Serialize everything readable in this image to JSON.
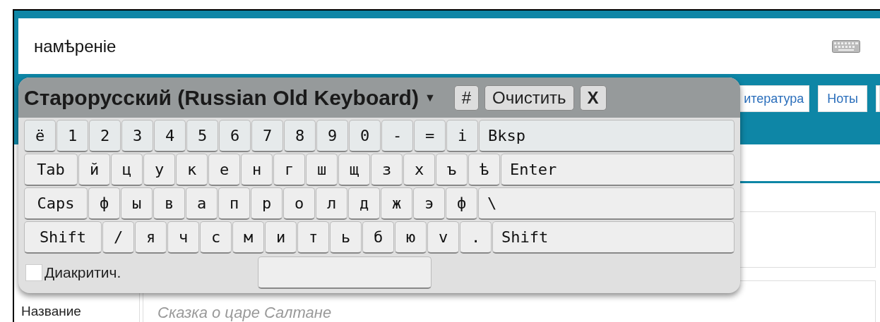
{
  "search": {
    "value": "намѣреніе"
  },
  "nav_buttons": [
    {
      "kind": "text",
      "label": "итература"
    },
    {
      "kind": "text",
      "label": "Ноты"
    },
    {
      "kind": "edge"
    }
  ],
  "form": {
    "title_label": "Название",
    "title_placeholder": "Сказка о царе Салтане"
  },
  "keyboard": {
    "title": "Старорусский (Russian Old Keyboard)",
    "dropdown": "▼",
    "buttons": [
      "#",
      "Очистить",
      "X"
    ],
    "rows": [
      {
        "keys": [
          {
            "label": "ё",
            "kind": "key"
          },
          {
            "label": "1",
            "kind": "key"
          },
          {
            "label": "2",
            "kind": "key"
          },
          {
            "label": "3",
            "kind": "key"
          },
          {
            "label": "4",
            "kind": "key"
          },
          {
            "label": "5",
            "kind": "key"
          },
          {
            "label": "6",
            "kind": "key"
          },
          {
            "label": "7",
            "kind": "key"
          },
          {
            "label": "8",
            "kind": "key"
          },
          {
            "label": "9",
            "kind": "key"
          },
          {
            "label": "0",
            "kind": "key"
          },
          {
            "label": "-",
            "kind": "key"
          },
          {
            "label": "=",
            "kind": "key"
          },
          {
            "label": "і",
            "kind": "key"
          },
          {
            "label": "Bksp",
            "kind": "fill"
          }
        ]
      },
      {
        "keys": [
          {
            "label": "Tab",
            "kind": "tab"
          },
          {
            "label": "й",
            "kind": "key"
          },
          {
            "label": "ц",
            "kind": "key"
          },
          {
            "label": "у",
            "kind": "key"
          },
          {
            "label": "к",
            "kind": "key"
          },
          {
            "label": "е",
            "kind": "key"
          },
          {
            "label": "н",
            "kind": "key"
          },
          {
            "label": "г",
            "kind": "key"
          },
          {
            "label": "ш",
            "kind": "key"
          },
          {
            "label": "щ",
            "kind": "key"
          },
          {
            "label": "з",
            "kind": "key"
          },
          {
            "label": "х",
            "kind": "key"
          },
          {
            "label": "ъ",
            "kind": "key"
          },
          {
            "label": "ѣ",
            "kind": "key"
          },
          {
            "label": "Enter",
            "kind": "fill"
          }
        ]
      },
      {
        "keys": [
          {
            "label": "Caps",
            "kind": "caps"
          },
          {
            "label": "ф",
            "kind": "key"
          },
          {
            "label": "ы",
            "kind": "key"
          },
          {
            "label": "в",
            "kind": "key"
          },
          {
            "label": "а",
            "kind": "key"
          },
          {
            "label": "п",
            "kind": "key"
          },
          {
            "label": "р",
            "kind": "key"
          },
          {
            "label": "о",
            "kind": "key"
          },
          {
            "label": "л",
            "kind": "key"
          },
          {
            "label": "д",
            "kind": "key"
          },
          {
            "label": "ж",
            "kind": "key"
          },
          {
            "label": "э",
            "kind": "key"
          },
          {
            "label": "ф",
            "kind": "key"
          },
          {
            "label": "\\",
            "kind": "fill"
          }
        ]
      },
      {
        "keys": [
          {
            "label": "Shift",
            "kind": "shift"
          },
          {
            "label": "/",
            "kind": "key"
          },
          {
            "label": "я",
            "kind": "key"
          },
          {
            "label": "ч",
            "kind": "key"
          },
          {
            "label": "с",
            "kind": "key"
          },
          {
            "label": "м",
            "kind": "key"
          },
          {
            "label": "и",
            "kind": "key"
          },
          {
            "label": "т",
            "kind": "key"
          },
          {
            "label": "ь",
            "kind": "key"
          },
          {
            "label": "б",
            "kind": "key"
          },
          {
            "label": "ю",
            "kind": "key"
          },
          {
            "label": "v",
            "kind": "key"
          },
          {
            "label": ".",
            "kind": "key"
          },
          {
            "label": "Shift",
            "kind": "fill"
          }
        ]
      }
    ],
    "diacritics": {
      "label": "Диакритич.",
      "checked": false
    }
  }
}
